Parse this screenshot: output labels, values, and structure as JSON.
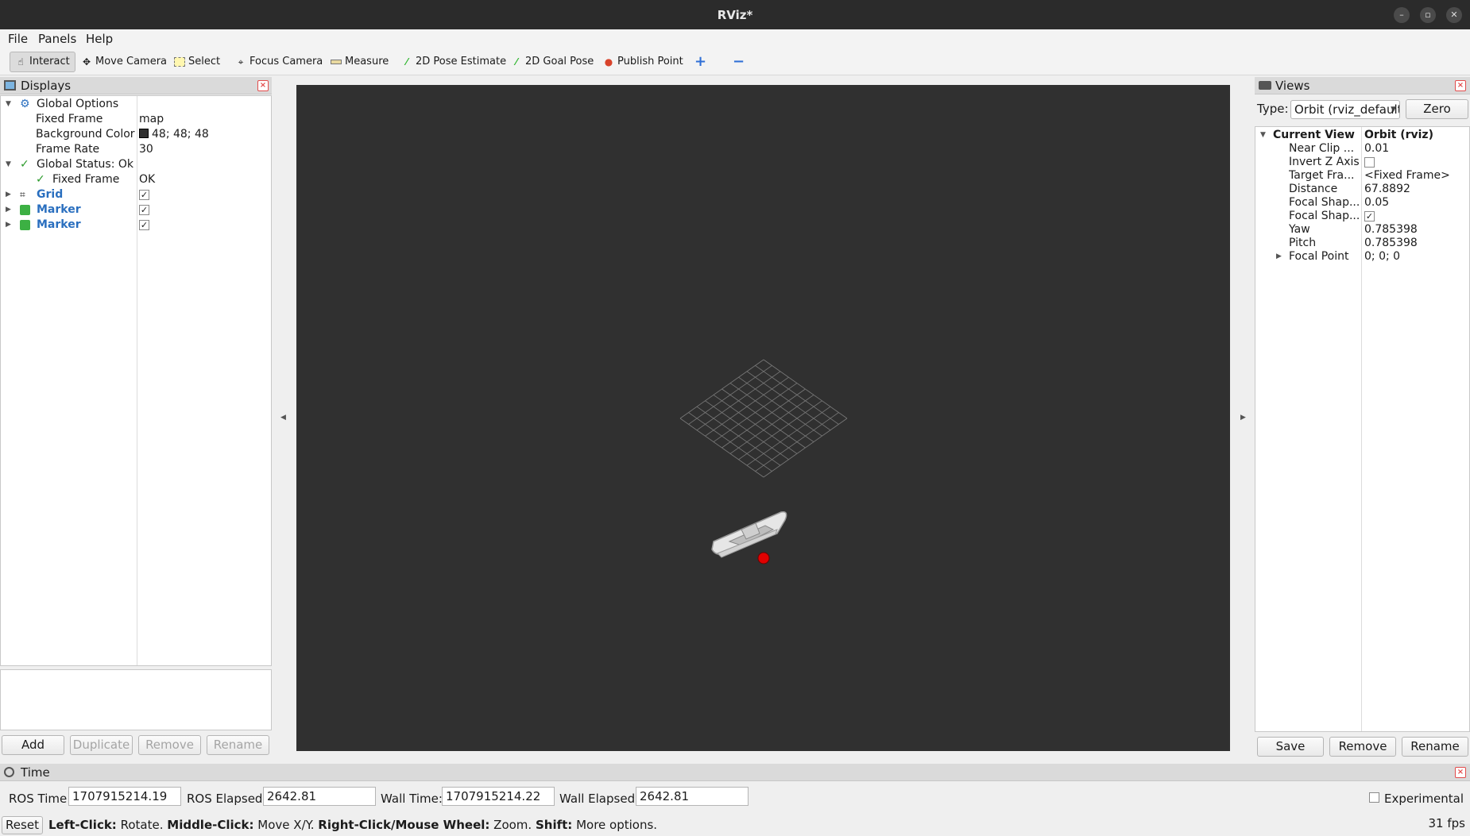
{
  "window": {
    "title": "RViz*"
  },
  "menu": {
    "file": "File",
    "panels": "Panels",
    "help": "Help"
  },
  "toolbar": {
    "interact": "Interact",
    "move_camera": "Move Camera",
    "select": "Select",
    "focus_camera": "Focus Camera",
    "measure": "Measure",
    "pose_estimate": "2D Pose Estimate",
    "goal_pose": "2D Goal Pose",
    "publish_point": "Publish Point"
  },
  "displays": {
    "title": "Displays",
    "global_options": "Global Options",
    "fixed_frame_label": "Fixed Frame",
    "fixed_frame_value": "map",
    "bg_color_label": "Background Color",
    "bg_color_value": "48; 48; 48",
    "frame_rate_label": "Frame Rate",
    "frame_rate_value": "30",
    "global_status": "Global Status: Ok",
    "status_fixed_frame_label": "Fixed Frame",
    "status_fixed_frame_value": "OK",
    "items": [
      {
        "label": "Grid",
        "checked": true
      },
      {
        "label": "Marker",
        "checked": true
      },
      {
        "label": "Marker",
        "checked": true
      }
    ],
    "buttons": {
      "add": "Add",
      "duplicate": "Duplicate",
      "remove": "Remove",
      "rename": "Rename"
    }
  },
  "views": {
    "title": "Views",
    "type_label": "Type:",
    "type_value": "Orbit (rviz_default_plugins)",
    "zero": "Zero",
    "current_view_label": "Current View",
    "current_view_value": "Orbit (rviz)",
    "props": [
      {
        "label": "Near Clip ...",
        "value": "0.01"
      },
      {
        "label": "Invert Z Axis",
        "value": ""
      },
      {
        "label": "Target Fra...",
        "value": "<Fixed Frame>"
      },
      {
        "label": "Distance",
        "value": "67.8892"
      },
      {
        "label": "Focal Shap...",
        "value": "0.05"
      },
      {
        "label": "Focal Shap...",
        "value": "✓"
      },
      {
        "label": "Yaw",
        "value": "0.785398"
      },
      {
        "label": "Pitch",
        "value": "0.785398"
      },
      {
        "label": "Focal Point",
        "value": "0; 0; 0"
      }
    ],
    "buttons": {
      "save": "Save",
      "remove": "Remove",
      "rename": "Rename"
    }
  },
  "time": {
    "title": "Time",
    "ros_time_label": "ROS Time:",
    "ros_time_value": "1707915214.19",
    "ros_elapsed_label": "ROS Elapsed:",
    "ros_elapsed_value": "2642.81",
    "wall_time_label": "Wall Time:",
    "wall_time_value": "1707915214.22",
    "wall_elapsed_label": "Wall Elapsed:",
    "wall_elapsed_value": "2642.81",
    "experimental": "Experimental"
  },
  "status": {
    "reset": "Reset",
    "left_click": "Left-Click:",
    "left_click_desc": "Rotate.",
    "middle_click": "Middle-Click:",
    "middle_click_desc": "Move X/Y.",
    "right_click": "Right-Click/Mouse Wheel:",
    "right_click_desc": "Zoom.",
    "shift": "Shift:",
    "shift_desc": "More options.",
    "fps": "31 fps"
  },
  "colors": {
    "render_bg": "#303030",
    "link_blue": "#2a6fbf",
    "marker_red": "#e00000"
  }
}
